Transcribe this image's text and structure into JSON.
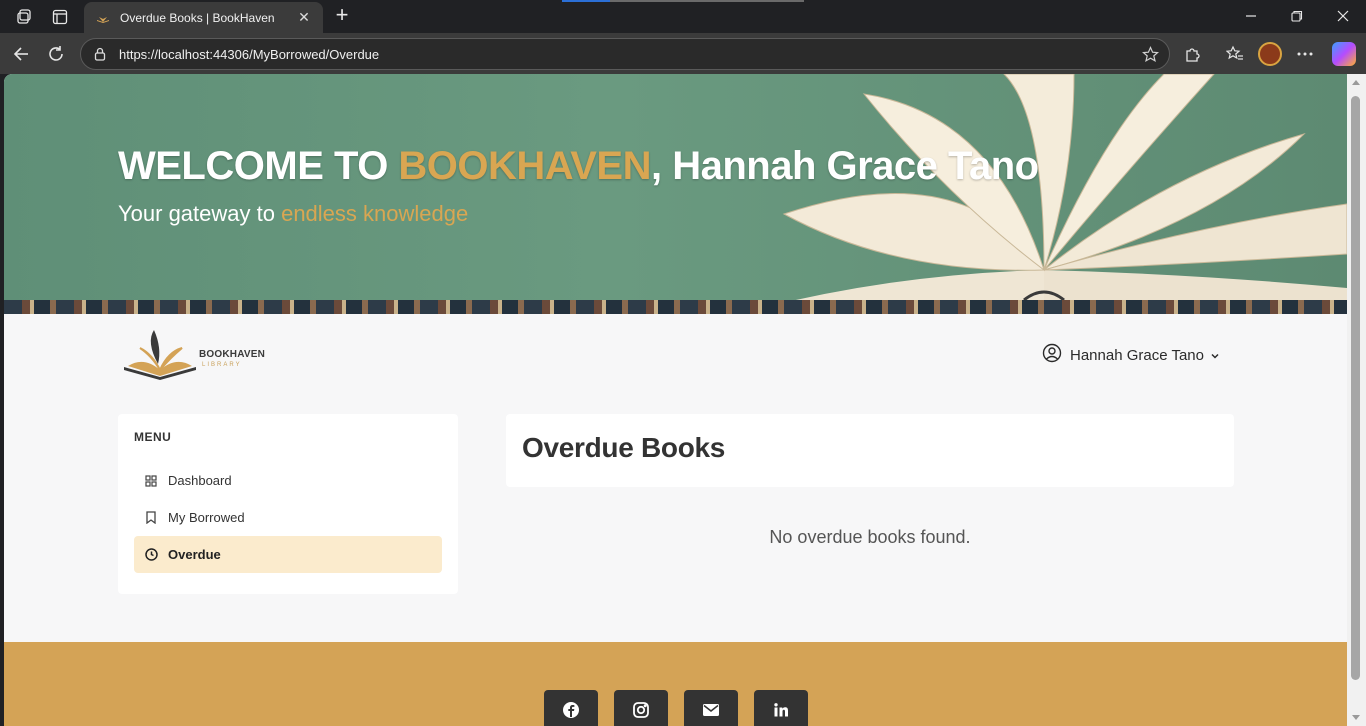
{
  "browser": {
    "tab_title": "Overdue Books | BookHaven",
    "url": "https://localhost:44306/MyBorrowed/Overdue",
    "icons": [
      "workspaces-icon",
      "tab-actions-icon",
      "close-icon",
      "new-tab-icon",
      "back-icon",
      "refresh-icon",
      "lock-icon",
      "favorite-star-icon",
      "extensions-icon",
      "favorites-icon",
      "profile-avatar",
      "more-icon",
      "copilot-icon"
    ]
  },
  "hero": {
    "welcome_prefix": "WELCOME TO ",
    "brand": "BOOKHAVEN",
    "welcome_suffix": ", Hannah Grace Tano",
    "tagline_prefix": "Your gateway to ",
    "tagline_accent": "endless knowledge",
    "accent_color": "#d9a652"
  },
  "header": {
    "logo_word": "BOOKHAVEN",
    "logo_sub": "LIBRARY",
    "user_name": "Hannah Grace Tano"
  },
  "sidebar": {
    "title": "MENU",
    "items": [
      {
        "label": "Dashboard",
        "icon": "dashboard-icon",
        "active": false
      },
      {
        "label": "My Borrowed",
        "icon": "bookmark-icon",
        "active": false
      },
      {
        "label": "Overdue",
        "icon": "clock-icon",
        "active": true
      }
    ]
  },
  "main": {
    "title": "Overdue Books",
    "empty_message": "No overdue books found."
  },
  "footer": {
    "color": "#d4a356",
    "social": [
      "facebook-icon",
      "instagram-icon",
      "email-icon",
      "linkedin-icon"
    ]
  }
}
